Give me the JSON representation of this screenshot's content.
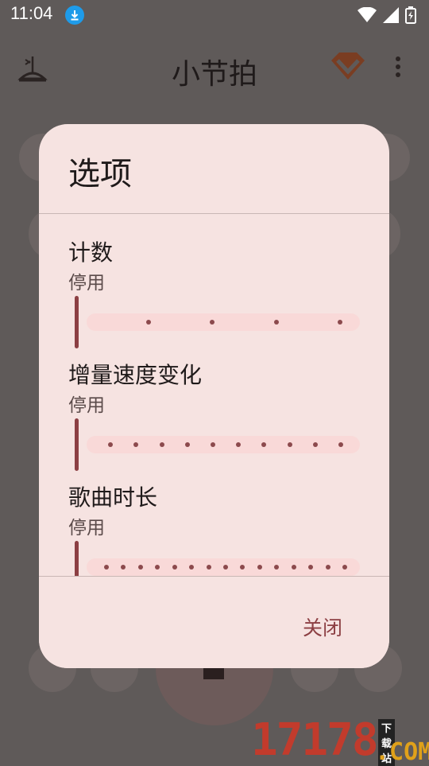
{
  "status_bar": {
    "time": "11:04"
  },
  "app_bar": {
    "title": "小节拍"
  },
  "dialog": {
    "title": "选项",
    "sections": [
      {
        "label": "计数",
        "value": "停用",
        "ticks": 4
      },
      {
        "label": "增量速度变化",
        "value": "停用",
        "ticks": 10
      },
      {
        "label": "歌曲时长",
        "value": "停用",
        "ticks": 15
      }
    ],
    "close_label": "关闭"
  },
  "watermark": {
    "number": "17178",
    "domain": ".COM",
    "tag": "下载站"
  },
  "colors": {
    "accent": "#8c3f43",
    "dialog_bg": "#f6e3e1",
    "track": "#f9d9d8"
  }
}
